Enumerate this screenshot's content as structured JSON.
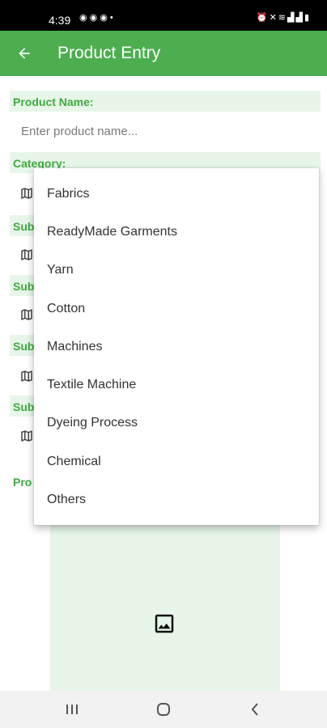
{
  "status_bar": {
    "time": "4:39",
    "left_icons": [
      "messenger-icon",
      "messenger-icon",
      "messenger-icon",
      "dot-icon"
    ],
    "right_icons": [
      "alarm-icon",
      "mute-icon",
      "wifi-icon",
      "signal-icon",
      "signal-icon",
      "battery-icon"
    ]
  },
  "app_bar": {
    "title": "Product Entry",
    "back_icon": "arrow-left-icon",
    "color": "#4cae4f"
  },
  "form": {
    "product_name_label": "Product Name:",
    "product_name_placeholder": "Enter product name...",
    "category_label": "Category:",
    "subcategory_label_partial": "Sub",
    "product_label_partial": "Pro",
    "field_icon": "map-icon",
    "label_color": "#3faa3f",
    "label_background": "#e7f6e8"
  },
  "image_picker": {
    "icon": "image-icon"
  },
  "category_dropdown": {
    "options": [
      "Fabrics",
      "ReadyMade Garments",
      "Yarn",
      "Cotton",
      "Machines",
      "Textile Machine",
      "Dyeing Process",
      "Chemical",
      "Others"
    ]
  },
  "nav_bar": {
    "icons": [
      "recent-apps-icon",
      "home-icon",
      "back-icon"
    ]
  }
}
